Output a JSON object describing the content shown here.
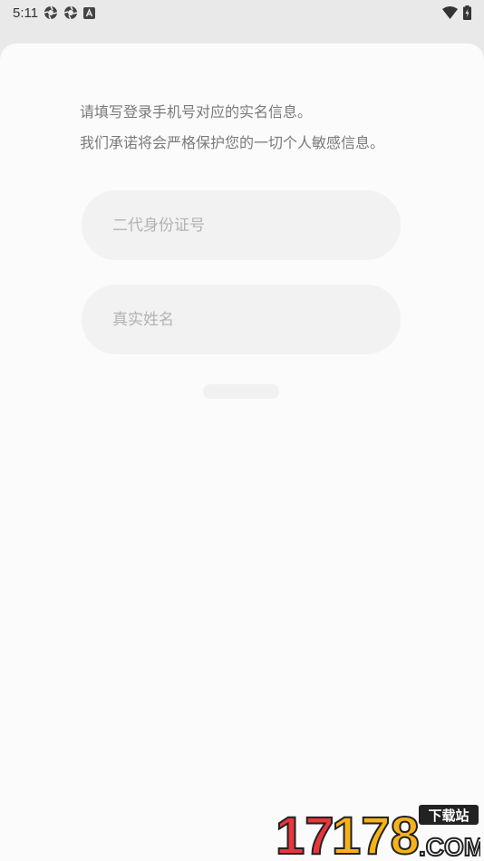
{
  "status_bar": {
    "time": "5:11",
    "left_icons": [
      "aperture-icon",
      "aperture-icon",
      "keyboard-a-icon"
    ],
    "right_icons": [
      "wifi-icon",
      "battery-charging-icon"
    ]
  },
  "form": {
    "notice_line1": "请填写登录手机号对应的实名信息。",
    "notice_line2": "我们承诺将会严格保护您的一切个人敏感信息。",
    "id_number": {
      "placeholder": "二代身份证号",
      "value": ""
    },
    "real_name": {
      "placeholder": "真实姓名",
      "value": ""
    }
  },
  "watermark": {
    "number": "17178",
    "site_label": "下载站",
    "domain_suffix": ".COM",
    "colors": {
      "red": "#e8363b",
      "yellow": "#f6b21b",
      "dark": "#222222"
    }
  }
}
